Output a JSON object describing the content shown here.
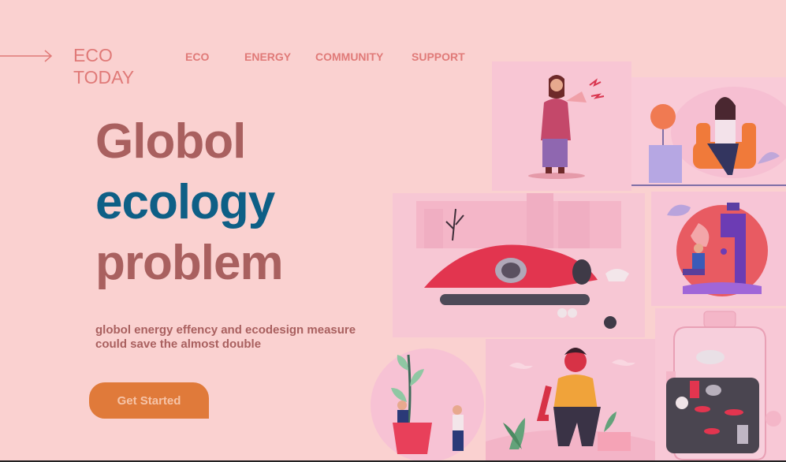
{
  "brand": {
    "line1": "ECO",
    "line2": "TODAY"
  },
  "nav": {
    "items": [
      "ECO",
      "ENERGY",
      "COMMUNITY",
      "SUPPORT"
    ]
  },
  "hero": {
    "line1": "Globol",
    "line2": "ecology",
    "line3": "problem",
    "subtitle": "globol energy effency and ecodesign measure could save the almost double",
    "cta_label": "Get Started"
  },
  "colors": {
    "background": "#fad1d0",
    "accent_brown": "#a9605f",
    "accent_blue": "#0e5f86",
    "nav_pink": "#e07a78",
    "cta_orange": "#e07a3a"
  },
  "illustrations": [
    "woman-megaphone-illustration",
    "woman-armchair-heater-illustration",
    "polluted-river-factory-illustration",
    "globe-faucet-illustration",
    "people-watering-plant-illustration",
    "sad-man-sitting-illustration",
    "plastic-bottle-ocean-illustration"
  ]
}
